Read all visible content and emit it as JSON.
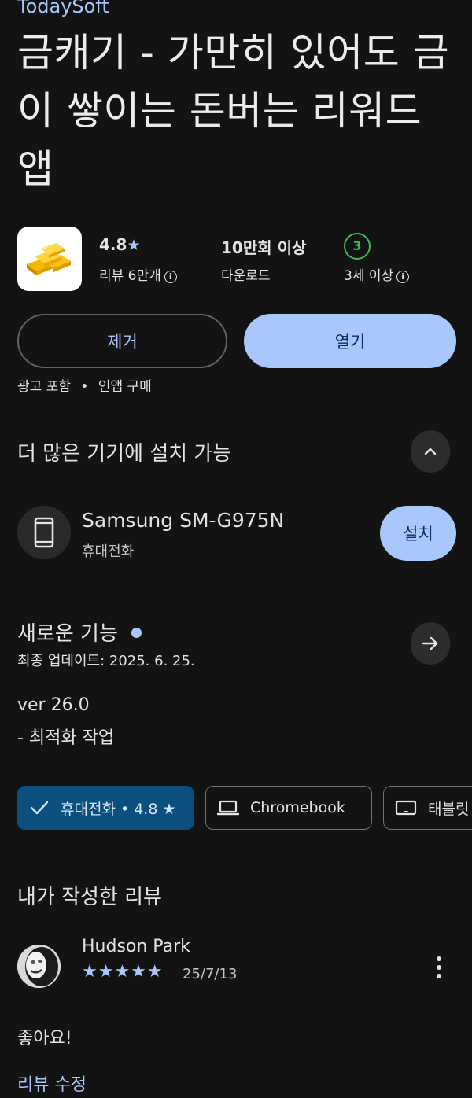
{
  "header": {
    "developer": "TodaySoft",
    "title": "금캐기 - 가만히 있어도 금이 쌓이는 돈버는 리워드 앱"
  },
  "stats": {
    "rating": "4.8",
    "rating_star": "★",
    "reviews_label": "리뷰 6만개",
    "downloads_value": "10만회 이상",
    "downloads_label": "다운로드",
    "age_badge": "3",
    "age_label": "3세 이상",
    "info_glyph": "i"
  },
  "actions": {
    "uninstall_label": "제거",
    "open_label": "열기",
    "ads_label": "광고 포함",
    "iap_label": "인앱 구매",
    "dot": "•"
  },
  "more_devices": {
    "title": "더 많은 기기에 설치 가능",
    "device_name": "Samsung SM-G975N",
    "device_type": "휴대전화",
    "install_label": "설치"
  },
  "whats_new": {
    "title": "새로운 기능",
    "updated": "최종 업데이트: 2025. 6. 25.",
    "version": "ver 26.0",
    "notes": "- 최적화 작업"
  },
  "device_chips": [
    {
      "label": "휴대전화 • 4.8 ★",
      "selected": true,
      "icon": "check-icon"
    },
    {
      "label": "Chromebook",
      "selected": false,
      "icon": "laptop-icon"
    },
    {
      "label": "태블릿",
      "selected": false,
      "icon": "tablet-icon"
    }
  ],
  "my_review": {
    "section_title": "내가 작성한 리뷰",
    "author": "Hudson Park",
    "stars": "★★★★★",
    "rating_value": 5,
    "date": "25/7/13",
    "text": "좋아요!",
    "edit_label": "리뷰 수정"
  },
  "colors": {
    "background": "#131313",
    "accent": "#a8c7fa",
    "selected_chip": "#0b4f7e",
    "age_badge": "#3fb950"
  }
}
